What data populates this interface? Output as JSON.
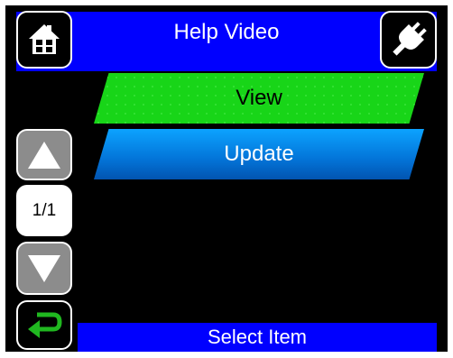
{
  "header": {
    "title": "Help Video",
    "home_icon": "house-icon",
    "plug_icon": "plug-icon"
  },
  "menu": {
    "items": [
      {
        "label": "View",
        "selected": true,
        "color": "#18d518"
      },
      {
        "label": "Update",
        "selected": false,
        "color": "#0374d8"
      }
    ]
  },
  "pager": {
    "indicator": "1/1",
    "up_icon": "triangle-up-icon",
    "down_icon": "triangle-down-icon"
  },
  "footer": {
    "back_icon": "return-arrow-icon",
    "status": "Select Item"
  },
  "colors": {
    "background": "#000000",
    "bar": "#0000ff",
    "button_gray": "#8c8c8c",
    "accent_green": "#18d518",
    "return_green": "#20b820"
  }
}
